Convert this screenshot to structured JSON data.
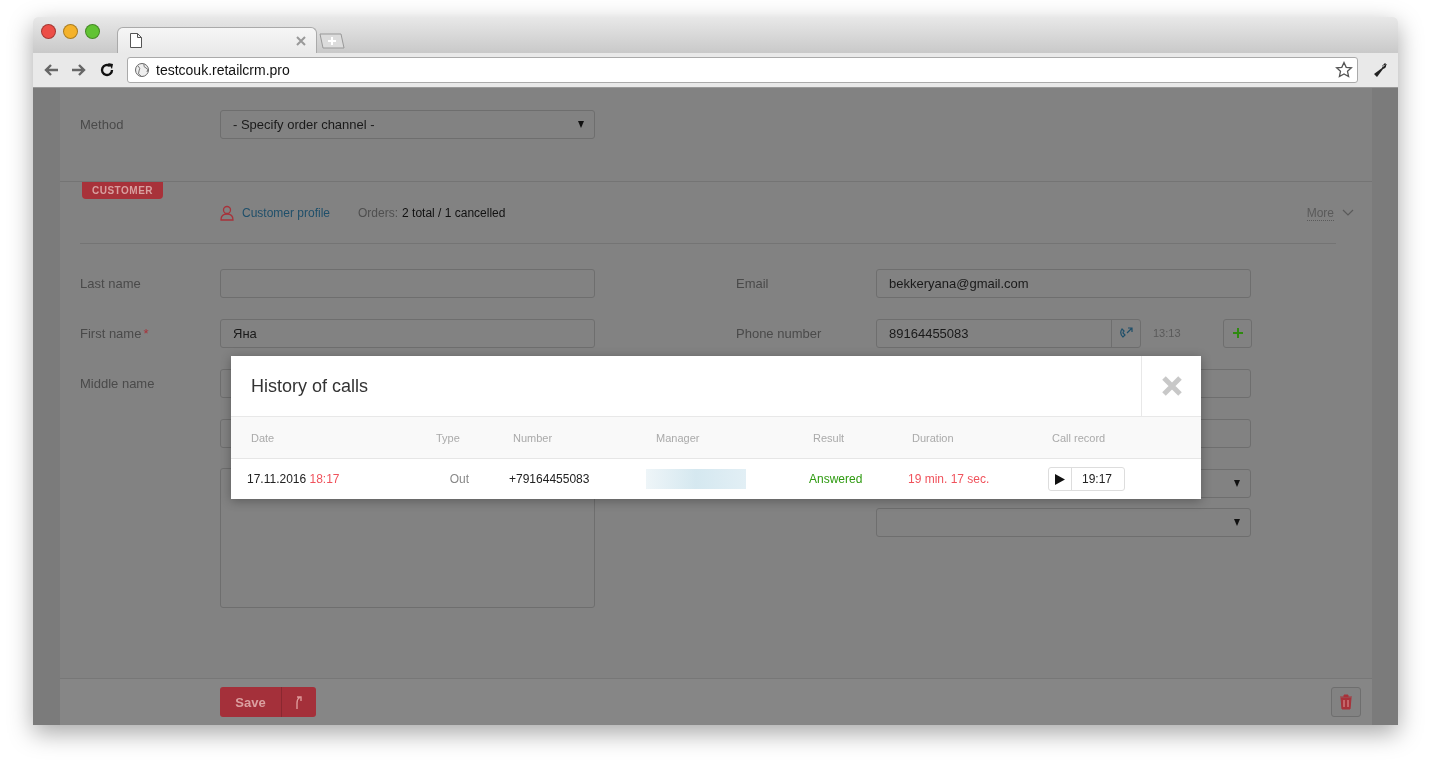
{
  "browser": {
    "url": "testcouk.retailcrm.pro"
  },
  "order": {
    "method": {
      "label": "Method",
      "value": "- Specify order channel -"
    }
  },
  "customer": {
    "badge": "CUSTOMER",
    "profile_link": "Customer profile",
    "orders_label": "Orders:",
    "orders_value": "2 total / 1 cancelled",
    "more": "More",
    "left_fields": [
      {
        "label": "Last name"
      },
      {
        "label": "First name",
        "required_mark": "*",
        "value": "Яна"
      },
      {
        "label": "Middle name"
      }
    ],
    "right_fields": [
      {
        "kind": "text",
        "label": "Email",
        "value": "bekkeryana@gmail.com"
      },
      {
        "kind": "phone",
        "label": "Phone number",
        "value": "89164455083",
        "time": "13:13"
      }
    ]
  },
  "footer": {
    "save_button": "Save"
  },
  "dialog": {
    "title": "History of calls",
    "columns": [
      "Date",
      "Type",
      "Number",
      "Manager",
      "Result",
      "Duration",
      "Call record"
    ],
    "rows": [
      {
        "date": "17.11.2016",
        "time": "18:17",
        "type": "Out",
        "number": "+79164455083",
        "result": "Answered",
        "duration": "19 min. 17 sec.",
        "record": "19:17"
      }
    ]
  }
}
